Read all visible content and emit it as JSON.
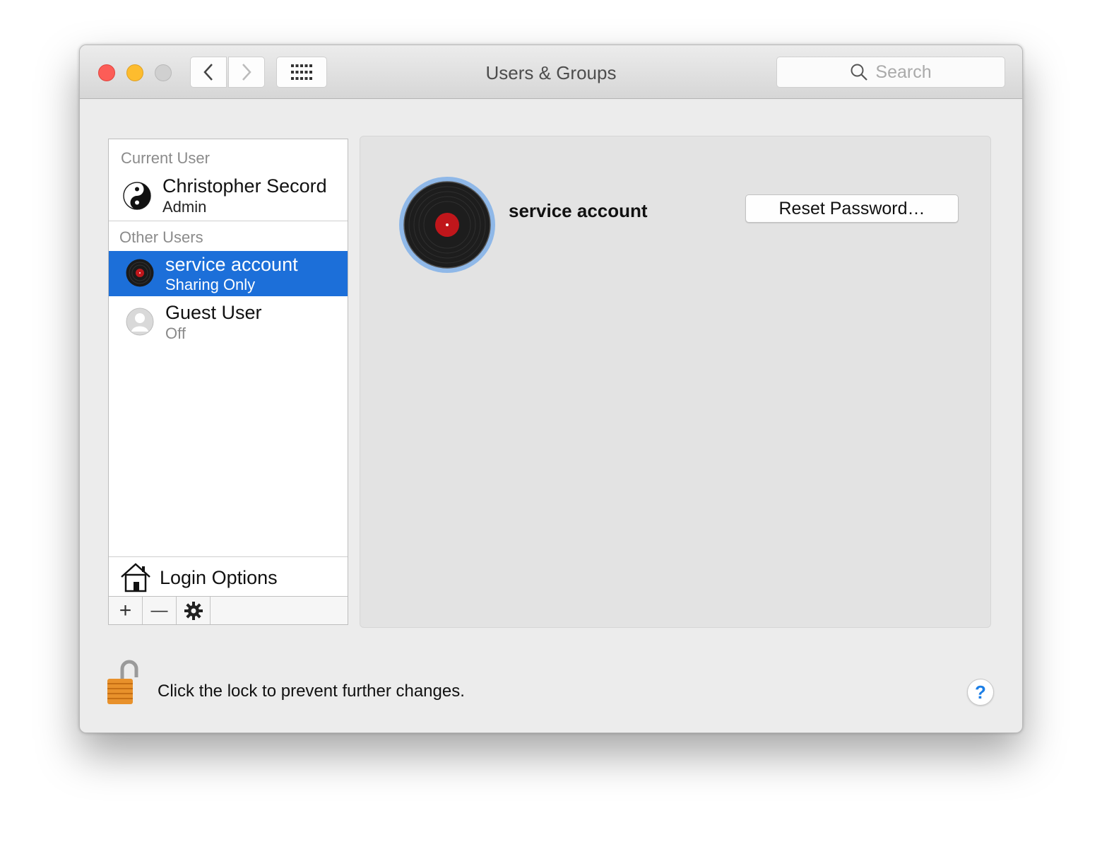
{
  "window": {
    "title": "Users & Groups"
  },
  "toolbar": {
    "search_placeholder": "Search"
  },
  "sidebar": {
    "current_user_header": "Current User",
    "current_user": {
      "name": "Christopher Secord",
      "role": "Admin"
    },
    "other_users_header": "Other Users",
    "other_users": [
      {
        "name": "service account",
        "role": "Sharing Only",
        "selected": true
      },
      {
        "name": "Guest User",
        "role": "Off",
        "selected": false
      }
    ],
    "login_options_label": "Login Options",
    "buttons": {
      "add": "+",
      "remove": "—"
    }
  },
  "detail": {
    "account_name": "service account",
    "reset_password_label": "Reset Password…"
  },
  "footer": {
    "lock_message": "Click the lock to prevent further changes.",
    "help_label": "?"
  },
  "colors": {
    "selection": "#1c6fd9",
    "close": "#fc5d57",
    "minimize": "#fdbc2e",
    "help": "#1b7ee6"
  }
}
